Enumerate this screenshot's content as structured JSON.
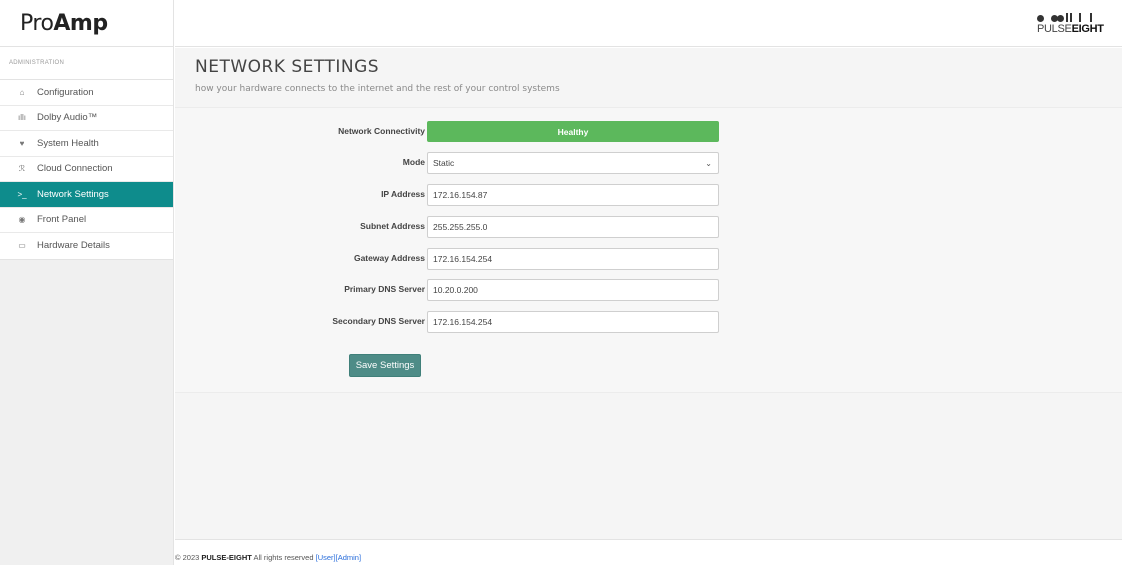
{
  "brand": {
    "part1": "Pro",
    "part2": "Amp"
  },
  "logo": {
    "text_light": "PULSE",
    "text_bold": "EIGHT"
  },
  "sidebar": {
    "heading": "ADMINISTRATION",
    "items": [
      {
        "label": "Configuration",
        "icon": "home-icon",
        "glyph": "⌂",
        "active": false
      },
      {
        "label": "Dolby Audio™",
        "icon": "audio-wave-icon",
        "glyph": "ıllı",
        "active": false
      },
      {
        "label": "System Health",
        "icon": "heart-icon",
        "glyph": "♥",
        "active": false
      },
      {
        "label": "Cloud Connection",
        "icon": "rss-icon",
        "glyph": "ℛ",
        "active": false
      },
      {
        "label": "Network Settings",
        "icon": "terminal-icon",
        "glyph": ">_",
        "active": true
      },
      {
        "label": "Front Panel",
        "icon": "circle-icon",
        "glyph": "◉",
        "active": false
      },
      {
        "label": "Hardware Details",
        "icon": "hdd-icon",
        "glyph": "▭",
        "active": false
      }
    ]
  },
  "page": {
    "title": "NETWORK SETTINGS",
    "subtitle": "how your hardware connects to the internet and the rest of your control systems"
  },
  "form": {
    "network_connectivity": {
      "label": "Network Connectivity",
      "value": "Healthy",
      "color": "#5cb85c"
    },
    "mode": {
      "label": "Mode",
      "value": "Static"
    },
    "ip_address": {
      "label": "IP Address",
      "value": "172.16.154.87"
    },
    "subnet_address": {
      "label": "Subnet Address",
      "value": "255.255.255.0"
    },
    "gateway_address": {
      "label": "Gateway Address",
      "value": "172.16.154.254"
    },
    "primary_dns": {
      "label": "Primary DNS Server",
      "value": "10.20.0.200"
    },
    "secondary_dns": {
      "label": "Secondary DNS Server",
      "value": "172.16.154.254"
    },
    "save_label": "Save Settings"
  },
  "footer": {
    "copyright": "© 2023",
    "company": "PULSE-EIGHT",
    "rights": "All rights reserved",
    "user_link": "[User]",
    "admin_link": "[Admin]"
  },
  "colors": {
    "accent": "#0e8c8c",
    "save_button": "#4e8c87",
    "healthy": "#5cb85c"
  }
}
